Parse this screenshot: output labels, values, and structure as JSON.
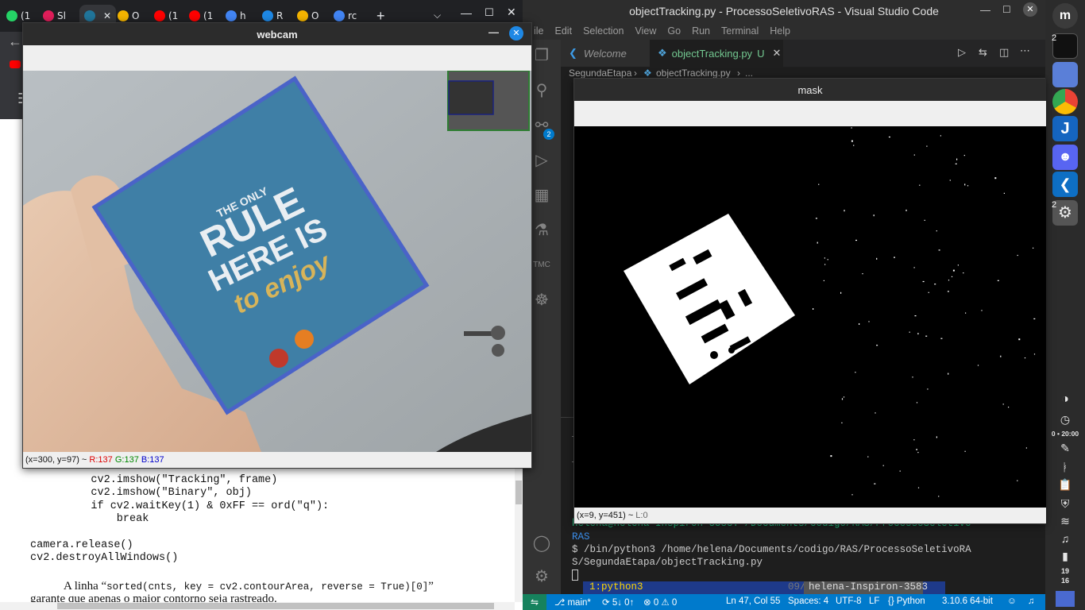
{
  "browser": {
    "tabs": [
      {
        "label": "(1",
        "color": "#25d366"
      },
      {
        "label": "Sl",
        "color": "#e01e5a"
      },
      {
        "label": "",
        "color": "#21759b"
      },
      {
        "label": "O",
        "color": "#f4b400"
      },
      {
        "label": "(1",
        "color": "#ff0000"
      },
      {
        "label": "(1",
        "color": "#ff0000"
      },
      {
        "label": "h",
        "color": "#4285f4"
      },
      {
        "label": "R",
        "color": "#1e88e5"
      },
      {
        "label": "O",
        "color": "#f4b400"
      },
      {
        "label": "rc",
        "color": "#4285f4"
      }
    ],
    "new_tab": "+",
    "code_lines": [
      "    cv2.imshow(\"Tracking\", frame)",
      "    cv2.imshow(\"Binary\", obj)",
      "    if cv2.waitKey(1) & 0xFF == ord(\"q\"):",
      "        break",
      "",
      "camera.release()",
      "cv2.destroyAllWindows()"
    ],
    "prose_line1_a": "A linha “",
    "prose_line1_code": "sorted(cnts, key = cv2.contourArea, reverse = True)[0]",
    "prose_line1_b": "”",
    "prose_line2": "garante que apenas o maior contorno seja rastreado."
  },
  "vscode": {
    "title": "objectTracking.py - ProcessoSeletivoRAS - Visual Studio Code",
    "menu": [
      "ile",
      "Edit",
      "Selection",
      "View",
      "Go",
      "Run",
      "Terminal",
      "Help"
    ],
    "tabs": [
      {
        "label": "Welcome",
        "active": false
      },
      {
        "label": "objectTracking.py",
        "badge": "U",
        "active": true
      }
    ],
    "breadcrumb": [
      "SegundaEtapa",
      "objectTracking.py",
      "..."
    ],
    "scm_badge": "2",
    "terminal": {
      "prompt_line": "helena@helena-Inspiron-3583:~/Documents/codigo/RAS/ProcessoSeletivo",
      "prompt_line2": "RAS",
      "command": "$ /bin/python3 /home/helena/Documents/codigo/RAS/ProcessoSeletivoRA",
      "command2": "S/SegundaEtapa/objectTracking.py",
      "tab_label": "1:python3",
      "tab_date": "09/04",
      "tab_host": "helena-Inspiron-3583"
    },
    "status": {
      "branch": "main*",
      "sync": "5↓ 0↑",
      "problems": "⊗ 0 ⚠ 0",
      "position": "Ln 47, Col 55",
      "spaces": "Spaces: 4",
      "encoding": "UTF-8",
      "eol": "LF",
      "language": "Python",
      "interpreter": "3.10.6 64-bit"
    }
  },
  "webcam": {
    "title": "webcam",
    "status_coords": "(x=300, y=97) ~ ",
    "status_r": "R:137",
    "status_g": "G:137",
    "status_b": "B:137",
    "book_lines": [
      "THE ONLY",
      "RULE",
      "HERE IS",
      "to enjoy"
    ]
  },
  "mask": {
    "title": "mask",
    "status_coords": "(x=9, y=451) ~ ",
    "status_l": "L:0"
  },
  "dock": {
    "workspace_badge_1": "2",
    "workspace_badge_2": "2",
    "clock_line1": "0 • 20:00",
    "time_h": "19",
    "time_m": "16"
  }
}
